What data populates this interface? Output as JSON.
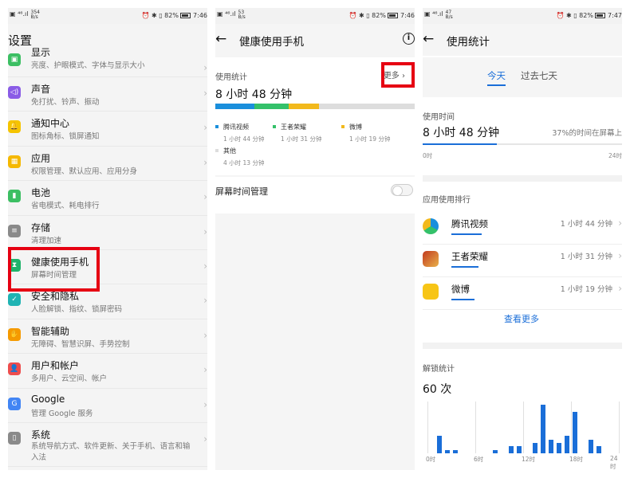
{
  "status": {
    "p1": {
      "speed": "354",
      "unit": "B/s",
      "battery": "82%",
      "time": "7:46"
    },
    "p2": {
      "speed": "53",
      "unit": "B/s",
      "battery": "82%",
      "time": "7:46"
    },
    "p3": {
      "speed": "47",
      "unit": "B/s",
      "battery": "82%",
      "time": "7:47"
    }
  },
  "settings": {
    "title": "设置",
    "items": [
      {
        "icon": "display-icon",
        "color": "#3cbf63",
        "title": "显示",
        "sub": "亮度、护眼模式、字体与显示大小"
      },
      {
        "icon": "sound-icon",
        "color": "#8a5ce6",
        "title": "声音",
        "sub": "免打扰、铃声、振动"
      },
      {
        "icon": "notification-icon",
        "color": "#f5c400",
        "title": "通知中心",
        "sub": "图标角标、锁屏通知"
      },
      {
        "icon": "apps-icon",
        "color": "#f5b800",
        "title": "应用",
        "sub": "权限管理、默认应用、应用分身"
      },
      {
        "icon": "battery-icon",
        "color": "#3cbf63",
        "title": "电池",
        "sub": "省电模式、耗电排行"
      },
      {
        "icon": "storage-icon",
        "color": "#8a8a8a",
        "title": "存储",
        "sub": "清理加速"
      },
      {
        "icon": "hourglass-icon",
        "color": "#1fb36b",
        "title": "健康使用手机",
        "sub": "屏幕时间管理"
      },
      {
        "icon": "shield-icon",
        "color": "#1fb3b3",
        "title": "安全和隐私",
        "sub": "人脸解锁、指纹、锁屏密码"
      },
      {
        "icon": "hand-icon",
        "color": "#f59a00",
        "title": "智能辅助",
        "sub": "无障碍、智慧识屏、手势控制"
      },
      {
        "icon": "user-icon",
        "color": "#ee4d4d",
        "title": "用户和帐户",
        "sub": "多用户、云空间、帐户"
      },
      {
        "icon": "google-icon",
        "color": "#4285f4",
        "title": "Google",
        "sub": "管理 Google 服务"
      },
      {
        "icon": "system-icon",
        "color": "#8a8a8a",
        "title": "系统",
        "sub": "系统导航方式、软件更新、关于手机、语言和输入法"
      }
    ]
  },
  "health": {
    "title": "健康使用手机",
    "usage_label": "使用统计",
    "more": "更多",
    "total": "8 小时 48 分钟",
    "segments": [
      {
        "name": "腾讯视频",
        "time": "1 小时 44 分钟",
        "color": "#1a8fdc",
        "fraction": 0.197
      },
      {
        "name": "王者荣耀",
        "time": "1 小时 31 分钟",
        "color": "#34c16a",
        "fraction": 0.172
      },
      {
        "name": "微博",
        "time": "1 小时 19 分钟",
        "color": "#f2b91c",
        "fraction": 0.15
      },
      {
        "name": "其他",
        "time": "4 小时 13 分钟",
        "color": "#dddddd",
        "fraction": 0.481
      }
    ],
    "screen_time_mgmt": "屏幕时间管理"
  },
  "stats": {
    "title": "使用统计",
    "tab_today": "今天",
    "tab_week": "过去七天",
    "usage_label": "使用时间",
    "total": "8 小时 48 分钟",
    "pct_text": "37%的时间在屏幕上",
    "pct": 0.37,
    "axis_start": "0时",
    "axis_end": "24时",
    "rank_label": "应用使用排行",
    "apps": [
      {
        "name": "腾讯视频",
        "time": "1 小时 44 分钟",
        "icon": "tencent-video-icon",
        "bar": 0.18
      },
      {
        "name": "王者荣耀",
        "time": "1 小时 31 分钟",
        "icon": "honor-of-kings-icon",
        "bar": 0.16
      },
      {
        "name": "微博",
        "time": "1 小时 19 分钟",
        "icon": "weibo-icon",
        "bar": 0.14
      }
    ],
    "see_more": "查看更多",
    "unlock_label": "解锁统计",
    "unlock_count": "60 次",
    "hour_ticks": [
      "0时",
      "6时",
      "12时",
      "18时",
      "24时"
    ]
  },
  "chart_data": {
    "type": "bar",
    "title": "",
    "xlabel": "",
    "ylabel": "",
    "x": [
      0,
      1,
      2,
      3,
      4,
      5,
      6,
      7,
      8,
      9,
      10,
      11,
      12,
      13,
      14,
      15,
      16,
      17,
      18,
      19,
      20,
      21,
      22,
      23
    ],
    "values": [
      0,
      5,
      1,
      1,
      0,
      0,
      0,
      0,
      1,
      0,
      2,
      2,
      0,
      3,
      14,
      4,
      3,
      5,
      12,
      0,
      4,
      2,
      0,
      0
    ],
    "ylim": [
      0,
      15
    ]
  }
}
